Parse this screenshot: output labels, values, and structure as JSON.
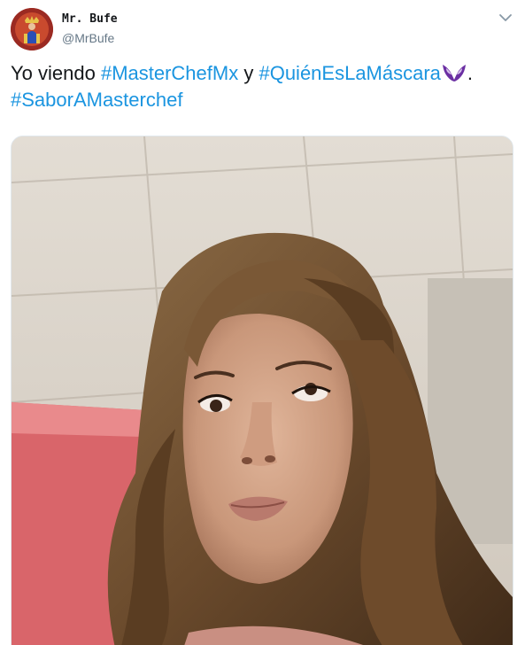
{
  "author": {
    "display_name": "Mr. Bufe",
    "handle": "@MrBufe",
    "avatar_icon": "crowned-figure-avatar"
  },
  "menu": {
    "icon": "chevron-down-icon"
  },
  "tweet": {
    "text_1": "Yo viendo ",
    "hashtag_1": "#MasterChefMx",
    "text_2": " y ",
    "hashtag_2": "#QuiénEsLaMáscara",
    "emoji": "purple-mask-icon",
    "text_3": ".",
    "hashtag_3": "#SaborAMasterchef"
  },
  "colors": {
    "hashtag": "#1b95e0",
    "text": "#14171a",
    "secondary": "#657786",
    "mask_emoji": "#6b2fa3"
  },
  "media": {
    "kind": "photo",
    "icon": "selfie-photo"
  }
}
